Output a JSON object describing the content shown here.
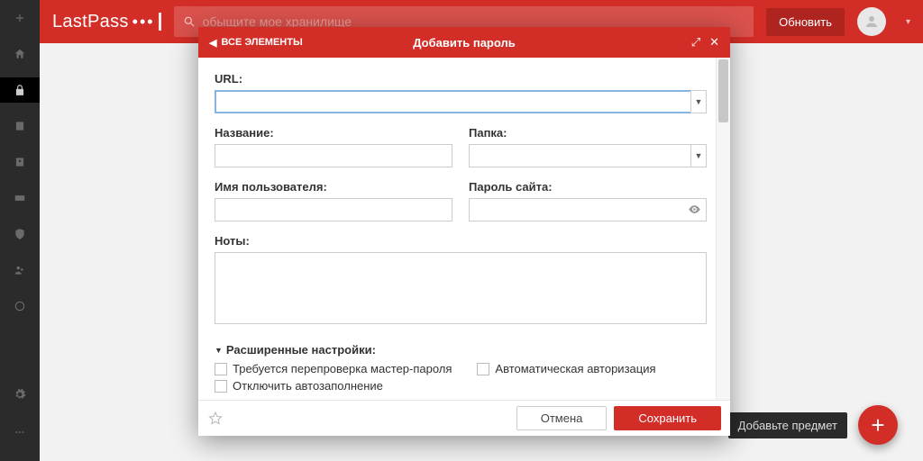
{
  "brand": {
    "name": "LastPass"
  },
  "topbar": {
    "search_placeholder": "обыщите мое хранилище",
    "upgrade_label": "Обновить",
    "user_name": ""
  },
  "modal": {
    "back_label": "ВСЕ ЭЛЕМЕНТЫ",
    "title": "Добавить пароль",
    "labels": {
      "url": "URL:",
      "name": "Название:",
      "folder": "Папка:",
      "username": "Имя пользователя:",
      "password": "Пароль сайта:",
      "notes": "Ноты:",
      "advanced": "Расширенные настройки:"
    },
    "values": {
      "url": "",
      "name": "",
      "folder": "",
      "username": "",
      "password": "",
      "notes": ""
    },
    "advanced_options": {
      "require_reprompt": "Требуется перепроверка мастер-пароля",
      "autologin": "Автоматическая авторизация",
      "disable_autofill": "Отключить автозаполнение"
    },
    "buttons": {
      "cancel": "Отмена",
      "save": "Сохранить"
    }
  },
  "fab": {
    "tooltip": "Добавьте предмет"
  }
}
